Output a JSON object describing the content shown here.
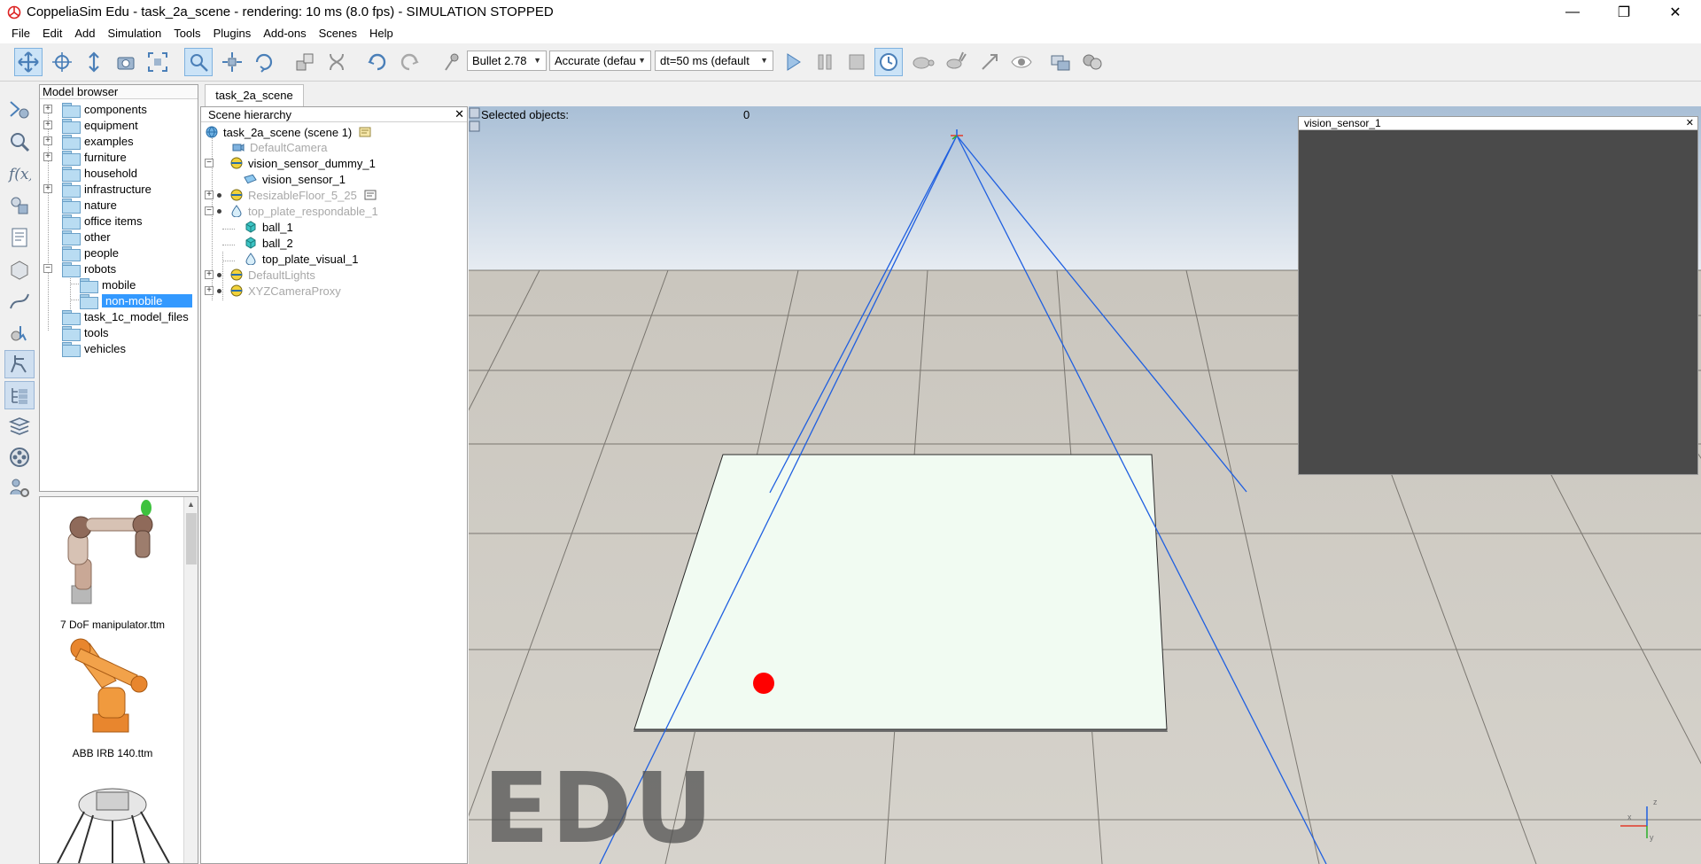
{
  "window": {
    "title": "CoppeliaSim Edu - task_2a_scene - rendering: 10 ms (8.0 fps) - SIMULATION STOPPED",
    "minimize": "—",
    "restore": "❐",
    "close": "✕"
  },
  "menu": [
    "File",
    "Edit",
    "Add",
    "Simulation",
    "Tools",
    "Plugins",
    "Add-ons",
    "Scenes",
    "Help"
  ],
  "toolbar": {
    "engine": "Bullet 2.78",
    "accuracy": "Accurate (defau",
    "timestep": "dt=50 ms (default",
    "icons": [
      "camera-pan-icon",
      "camera-rotate-icon",
      "camera-shift-icon",
      "camera-angle-icon",
      "fit-to-view-icon",
      "select-icon",
      "translate-icon",
      "rotate-icon",
      "assemble-icon",
      "transfer-dna-icon",
      "undo-icon",
      "redo-icon",
      "dynamics-icon",
      "play-icon",
      "pause-icon",
      "stop-icon",
      "realtime-icon",
      "slow-down-icon",
      "speed-up-icon",
      "thread-icon",
      "visualization-icon",
      "page-selector-icon",
      "scene-selector-icon"
    ]
  },
  "model_browser": {
    "title": "Model browser",
    "items": [
      {
        "label": "components",
        "expandable": true
      },
      {
        "label": "equipment",
        "expandable": true
      },
      {
        "label": "examples",
        "expandable": true
      },
      {
        "label": "furniture",
        "expandable": true
      },
      {
        "label": "household",
        "expandable": false
      },
      {
        "label": "infrastructure",
        "expandable": true
      },
      {
        "label": "nature",
        "expandable": false
      },
      {
        "label": "office items",
        "expandable": false
      },
      {
        "label": "other",
        "expandable": false
      },
      {
        "label": "people",
        "expandable": false
      },
      {
        "label": "robots",
        "expandable": true,
        "expanded": true
      },
      {
        "label": "mobile",
        "child": true
      },
      {
        "label": "non-mobile",
        "child": true,
        "selected": true
      },
      {
        "label": "task_1c_model_files",
        "expandable": false
      },
      {
        "label": "tools",
        "expandable": false
      },
      {
        "label": "vehicles",
        "expandable": false
      }
    ]
  },
  "models": [
    {
      "caption": "7 DoF manipulator.ttm"
    },
    {
      "caption": "ABB IRB 140.ttm"
    }
  ],
  "scene_tab": "task_2a_scene",
  "hierarchy": {
    "title": "Scene hierarchy",
    "close": "✕",
    "rows": [
      {
        "label": "task_2a_scene (scene 1)",
        "dim": false
      },
      {
        "label": "DefaultCamera",
        "dim": true
      },
      {
        "label": "vision_sensor_dummy_1",
        "dim": false
      },
      {
        "label": "vision_sensor_1",
        "dim": false
      },
      {
        "label": "ResizableFloor_5_25",
        "dim": true
      },
      {
        "label": "top_plate_respondable_1",
        "dim": true
      },
      {
        "label": "ball_1",
        "dim": false
      },
      {
        "label": "ball_2",
        "dim": false
      },
      {
        "label": "top_plate_visual_1",
        "dim": false
      },
      {
        "label": "DefaultLights",
        "dim": true
      },
      {
        "label": "XYZCameraProxy",
        "dim": true
      }
    ]
  },
  "viewport": {
    "selected_label": "Selected objects:",
    "selected_count": "0",
    "watermark": "EDU",
    "axis_x": "x",
    "axis_y": "y",
    "axis_z": "z"
  },
  "vision_window": {
    "title": "vision_sensor_1",
    "close": "✕"
  },
  "colors": {
    "sky_top": "#a9bfd6",
    "sky_bottom": "#e7ecf2",
    "floor": "#cfcbc3",
    "plate": "#f1fbf2",
    "ball": "#ff0000",
    "sensor_lines": "#1f5fe0",
    "vision_bg": "#4a4a4a"
  }
}
